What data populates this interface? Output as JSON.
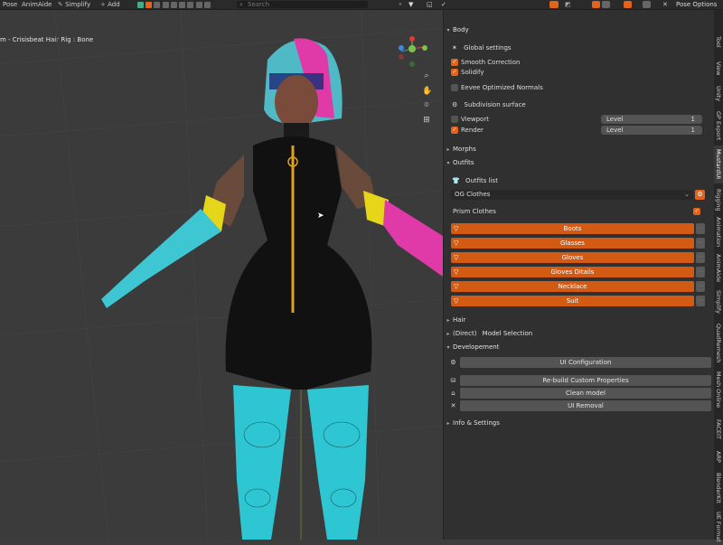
{
  "header": {
    "menus": [
      "Pose",
      "AnimAide",
      "Simplify",
      "Add"
    ],
    "transform_orientation": "Global",
    "search_placeholder": "Search",
    "pose_options": "Pose Options"
  },
  "viewport": {
    "title": "m - Crisisbeat Hair Rig : Bone"
  },
  "panel": {
    "body": "Body",
    "global_settings": "Global settings",
    "smooth_correction": "Smooth Correction",
    "solidify": "Solidify",
    "eevee": "Eevee Optimized Normals",
    "subdivision": "Subdivision surface",
    "viewport_label": "Viewport",
    "render_label": "Render",
    "level_label": "Level",
    "viewport_level": "1",
    "render_level": "1",
    "morphs": "Morphs",
    "outfits": "Outfits",
    "outfits_list": "Outfits list",
    "outfit_selected": "OG Clothes",
    "prism_clothes": "Prism Clothes",
    "outfit_items": [
      "Boots",
      "Glasses",
      "Gloves",
      "Gloves Ditails",
      "Necklace",
      "Suit"
    ],
    "hair": "Hair",
    "direct_prefix": "(Direct)",
    "model_selection": "Model Selection",
    "developement": "Developement",
    "ui_configuration": "UI Configuration",
    "rebuild": "Re-build Custom Properties",
    "clean_model": "Clean model",
    "ui_removal": "UI Removal",
    "info_settings": "Info & Settings"
  },
  "tabs": [
    "Tool",
    "View",
    "Unity",
    "GP Export",
    "MustardUI",
    "Rigging",
    "Animation",
    "AnimAide",
    "Simplify",
    "QuadRemesh",
    "Mesh Online",
    "FACEIT",
    "ARP",
    "BlenderKit",
    "UE Format"
  ],
  "colors": {
    "accent_orange": "#d35a13",
    "checkbox_orange": "#e2631b",
    "panel_bg": "#303030",
    "viewport_bg": "#3b3b3b"
  }
}
